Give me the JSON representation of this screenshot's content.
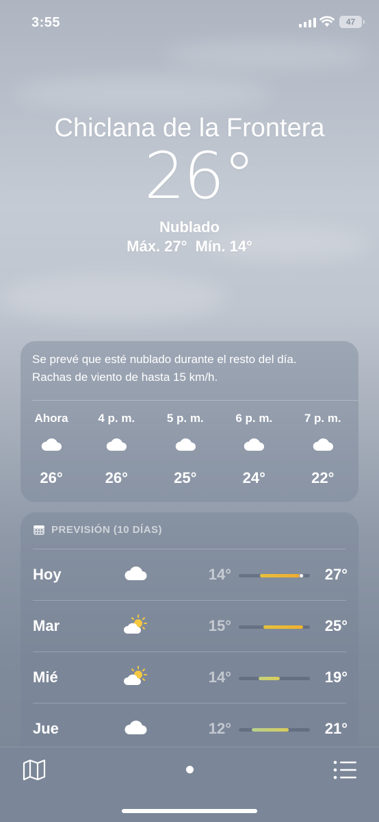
{
  "status_bar": {
    "time": "3:55",
    "battery": "47"
  },
  "header": {
    "city": "Chiclana de la Frontera",
    "temperature": "26°",
    "condition": "Nublado",
    "high": "Máx. 27°",
    "low": "Mín. 14°"
  },
  "hourly": {
    "summary_line1": "Se prevé que esté nublado durante el resto del día.",
    "summary_line2": "Rachas de viento de hasta 15 km/h.",
    "items": [
      {
        "label": "Ahora",
        "icon": "cloud-icon",
        "temp": "26°"
      },
      {
        "label": "4 p. m.",
        "icon": "cloud-icon",
        "temp": "26°"
      },
      {
        "label": "5 p. m.",
        "icon": "cloud-icon",
        "temp": "25°"
      },
      {
        "label": "6 p. m.",
        "icon": "cloud-icon",
        "temp": "24°"
      },
      {
        "label": "7 p. m.",
        "icon": "cloud-icon",
        "temp": "22°"
      }
    ]
  },
  "daily": {
    "title": "PREVISIÓN (10 DÍAS)",
    "days": [
      {
        "day": "Hoy",
        "icon": "cloud-icon",
        "low": "14°",
        "high": "27°",
        "bar_start": 0.3,
        "bar_end": 0.9,
        "current": 0.88,
        "color_from": "#e6c23a",
        "color_to": "#f0a830"
      },
      {
        "day": "Mar",
        "icon": "partly-sunny-icon",
        "low": "15°",
        "high": "25°",
        "bar_start": 0.35,
        "bar_end": 0.9,
        "color_from": "#e6c23a",
        "color_to": "#f0b030"
      },
      {
        "day": "Mié",
        "icon": "partly-sunny-icon",
        "low": "14°",
        "high": "19°",
        "bar_start": 0.28,
        "bar_end": 0.58,
        "color_from": "#c6d27a",
        "color_to": "#d8cc5a"
      },
      {
        "day": "Jue",
        "icon": "cloud-icon",
        "low": "12°",
        "high": "21°",
        "bar_start": 0.18,
        "bar_end": 0.7,
        "color_from": "#b8d090",
        "color_to": "#d8cc5a"
      }
    ]
  }
}
